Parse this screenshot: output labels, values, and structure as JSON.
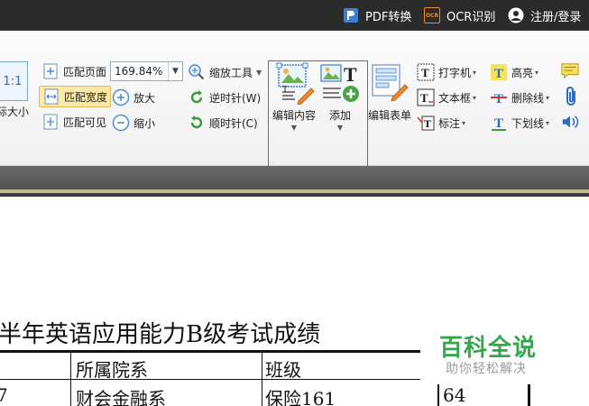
{
  "topbar": {
    "pdf_convert": "PDF转换",
    "ocr_icon_text": "OCR",
    "ocr": "OCR识别",
    "login": "注册/登录"
  },
  "ribbon": {
    "actual_size_icon_text": "1:1",
    "actual_size": "际大小",
    "fit_page": "匹配页面",
    "fit_width": "匹配宽度",
    "fit_visible": "匹配可见",
    "zoom_value": "169.84%",
    "zoom_in": "放大",
    "zoom_out": "缩小",
    "zoom_tool": "缩放工具",
    "rotate_ccw": "逆时针(W)",
    "rotate_cw": "顺时针(C)",
    "edit_content": "编辑内容",
    "add": "添加",
    "edit_form": "编辑表单",
    "typewriter": "打字机",
    "textbox": "文本框",
    "callout": "标注",
    "highlight": "高亮",
    "strikeout": "删除线",
    "underline": "下划线"
  },
  "document": {
    "title": "半年英语应用能力B级考试成绩",
    "headers": [
      "所属院系",
      "班级"
    ],
    "row": [
      "7",
      "财会金融系",
      "保险161",
      "64"
    ]
  },
  "watermark": {
    "title": "百科全说",
    "subtitle": "助你轻松解决"
  },
  "colors": {
    "topbar": "#2b2b2b",
    "selected": "#fde9a6",
    "highlight_border": "#e53935",
    "watermark": "#31a84a"
  }
}
